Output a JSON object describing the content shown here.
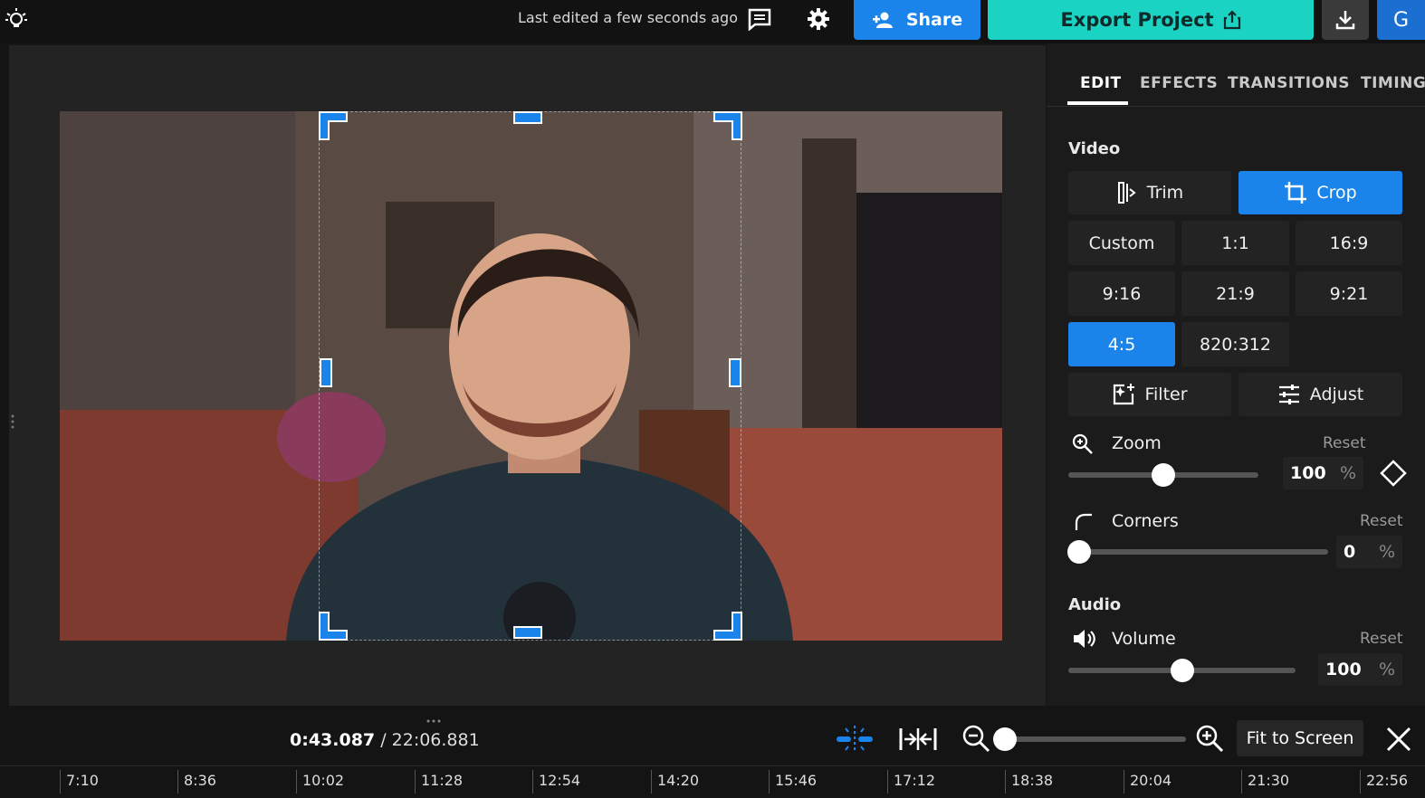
{
  "header": {
    "last_edited": "Last edited a few seconds ago",
    "share_label": "Share",
    "export_label": "Export Project",
    "avatar_initial": "G"
  },
  "colors": {
    "accent_blue": "#1a84ea",
    "export_teal": "#1ad3c3"
  },
  "panel": {
    "tabs": [
      {
        "label": "EDIT",
        "active": true
      },
      {
        "label": "EFFECTS",
        "active": false
      },
      {
        "label": "TRANSITIONS",
        "active": false
      },
      {
        "label": "TIMING",
        "active": false
      }
    ],
    "video_label": "Video",
    "trim_label": "Trim",
    "crop_label": "Crop",
    "ratios": [
      "Custom",
      "1:1",
      "16:9",
      "9:16",
      "21:9",
      "9:21",
      "4:5",
      "820:312"
    ],
    "selected_ratio": "4:5",
    "filter_label": "Filter",
    "adjust_label": "Adjust",
    "zoom": {
      "label": "Zoom",
      "reset": "Reset",
      "value": "100",
      "unit": "%",
      "level": 0.5
    },
    "corners": {
      "label": "Corners",
      "reset": "Reset",
      "value": "0",
      "unit": "%",
      "level": 0.0
    },
    "audio_label": "Audio",
    "volume": {
      "label": "Volume",
      "reset": "Reset",
      "value": "100",
      "unit": "%",
      "level": 0.5
    }
  },
  "timeline": {
    "current_time": "0:43.087",
    "separator": "/",
    "total_time": "22:06.881",
    "fit_label": "Fit to Screen",
    "ticks": [
      "7:10",
      "8:36",
      "10:02",
      "11:28",
      "12:54",
      "14:20",
      "15:46",
      "17:12",
      "18:38",
      "20:04",
      "21:30",
      "22:56"
    ]
  }
}
